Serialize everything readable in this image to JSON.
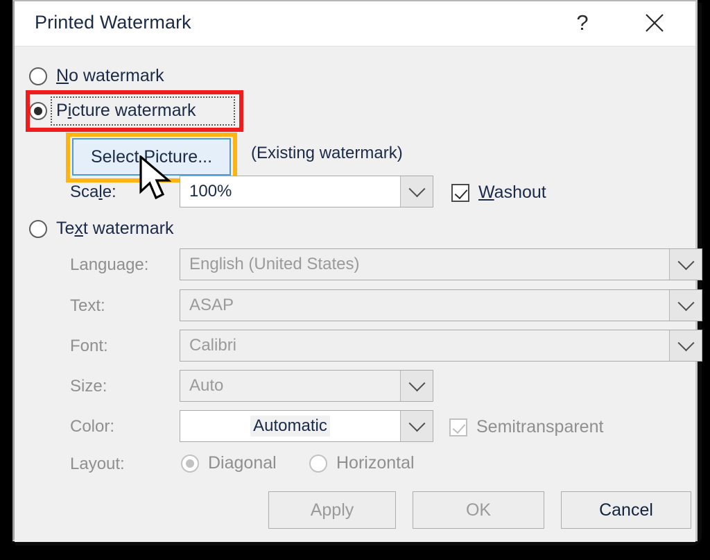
{
  "window": {
    "title": "Printed Watermark",
    "help_icon": "?",
    "close_icon": "close-icon"
  },
  "options": {
    "no_watermark": {
      "label": "No watermark",
      "accel": "N",
      "selected": false
    },
    "picture_watermark": {
      "label": "Picture watermark",
      "accel": "P",
      "selected": true
    },
    "text_watermark": {
      "label": "Text watermark",
      "accel": "x",
      "selected": false
    }
  },
  "picture_section": {
    "select_picture_button": "Select Picture...",
    "existing_note": "(Existing watermark)",
    "scale_label": "Scale:",
    "scale_accel": "l",
    "scale_value": "100%",
    "washout_label": "Washout",
    "washout_accel": "W",
    "washout_checked": true
  },
  "text_section": {
    "language_label": "Language:",
    "language_value": "English (United States)",
    "text_label": "Text:",
    "text_value": "ASAP",
    "font_label": "Font:",
    "font_value": "Calibri",
    "size_label": "Size:",
    "size_value": "Auto",
    "color_label": "Color:",
    "color_value": "Automatic",
    "semitransparent_label": "Semitransparent",
    "semitransparent_checked": true,
    "layout_label": "Layout:",
    "layout_diagonal": "Diagonal",
    "layout_horizontal": "Horizontal",
    "layout_selected": "Diagonal"
  },
  "footer": {
    "apply": "Apply",
    "ok": "OK",
    "cancel": "Cancel"
  },
  "annotations": {
    "red_highlight_target": "Picture watermark",
    "orange_highlight_target": "Select Picture..."
  },
  "colors": {
    "highlight_red": "#ee1c1c",
    "highlight_orange": "#ffb414",
    "dialog_bg": "#f0f0f0",
    "titlebar_bg": "#ffffff",
    "hover_blue": "#e4eff9",
    "hover_border": "#4d9ad4"
  }
}
